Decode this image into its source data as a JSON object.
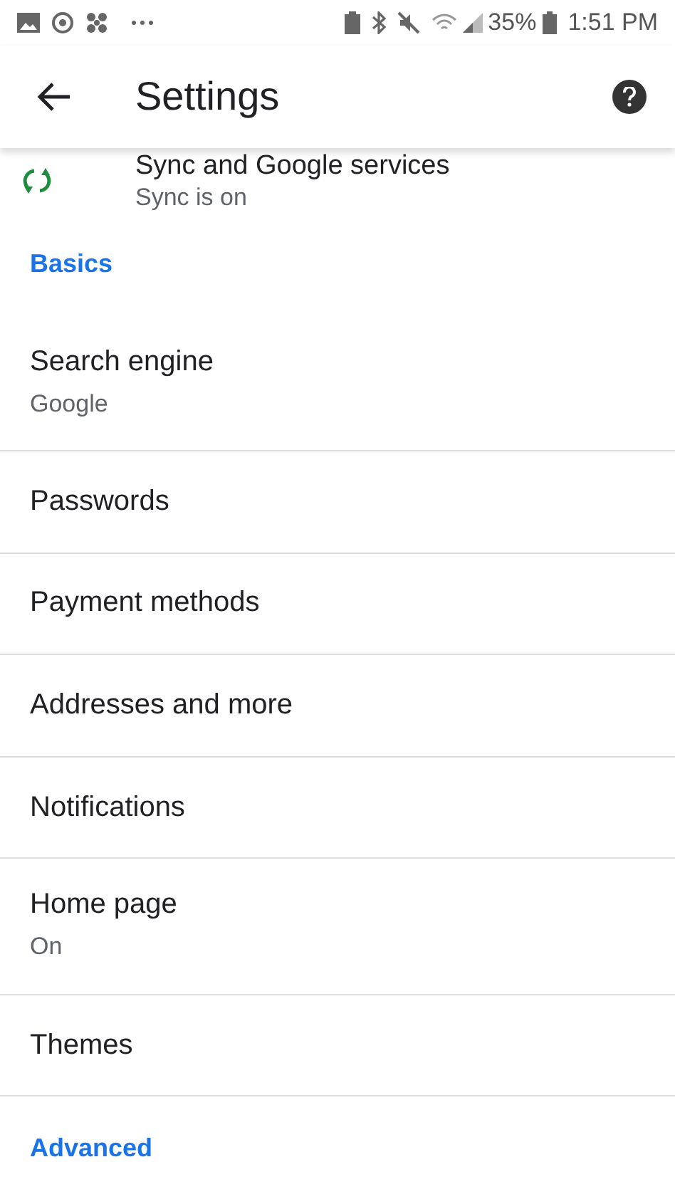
{
  "status_bar": {
    "battery": "35%",
    "time": "1:51 PM"
  },
  "app_bar": {
    "title": "Settings"
  },
  "items": [
    {
      "kind": "account",
      "title": "Sync and Google services",
      "subtitle": "Sync is on"
    },
    {
      "kind": "header",
      "title": "Basics"
    },
    {
      "kind": "row",
      "title": "Search engine",
      "subtitle": "Google"
    },
    {
      "kind": "row",
      "title": "Passwords"
    },
    {
      "kind": "row",
      "title": "Payment methods"
    },
    {
      "kind": "row",
      "title": "Addresses and more"
    },
    {
      "kind": "row",
      "title": "Notifications"
    },
    {
      "kind": "row",
      "title": "Home page",
      "subtitle": "On"
    },
    {
      "kind": "row",
      "title": "Themes"
    },
    {
      "kind": "header",
      "title": "Advanced"
    }
  ]
}
